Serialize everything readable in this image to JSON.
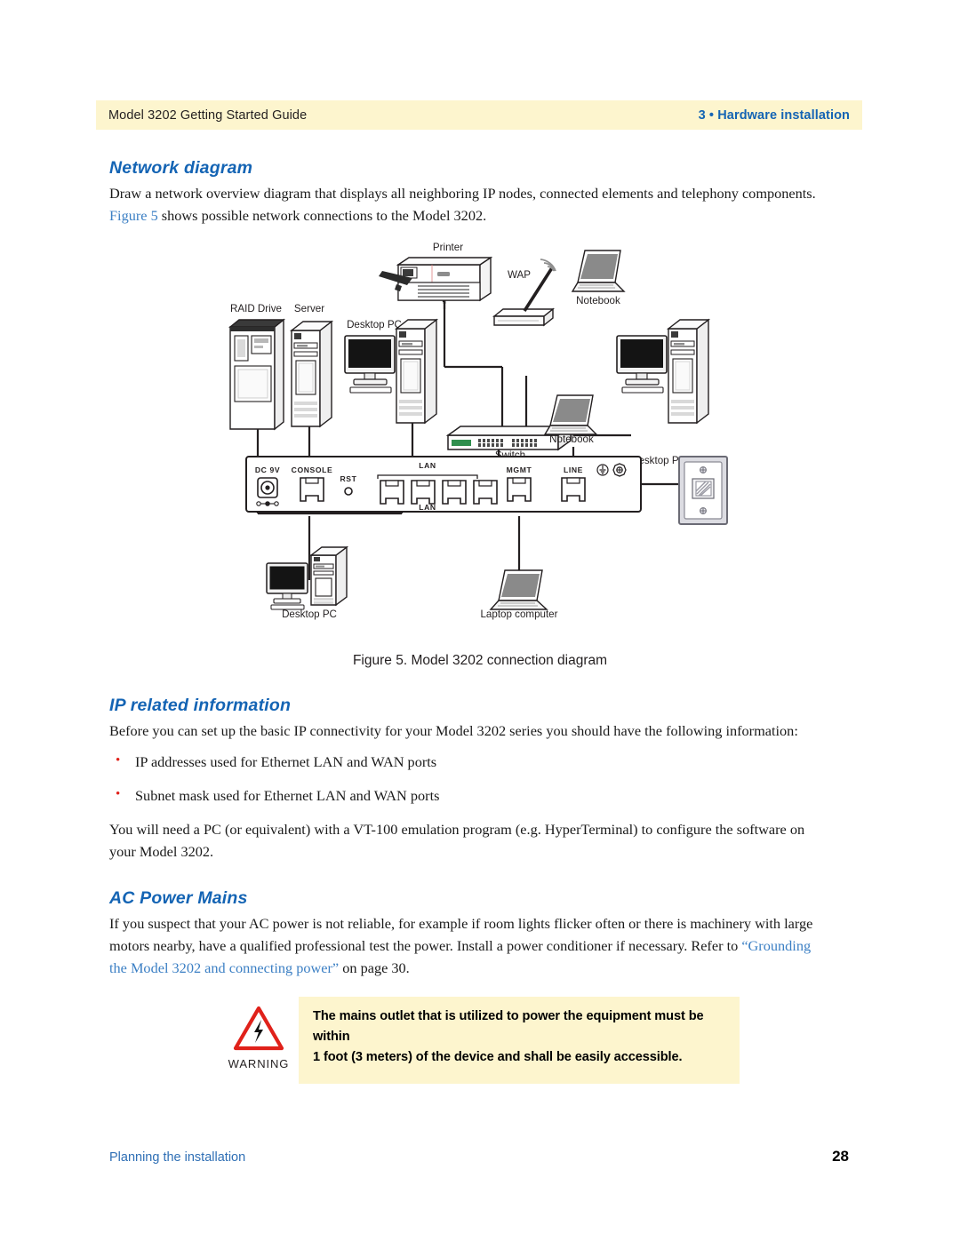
{
  "header": {
    "left": "Model 3202 Getting Started Guide",
    "right": "3 • Hardware installation",
    "band_color": "#FDF5CE",
    "accent_color": "#1464B4"
  },
  "sections": {
    "network_diagram": {
      "heading": "Network diagram",
      "paragraph_a": "Draw a network overview diagram that displays all neighboring IP nodes, connected elements and telephony components.",
      "figure_ref": "Figure 5",
      "paragraph_b": "shows possible network connections to the Model 3202."
    },
    "ip_related": {
      "heading": "IP related information",
      "paragraph": "Before you can set up the basic IP connectivity for your Model 3202 series you should have the following information:",
      "bullets": [
        "IP addresses used for Ethernet LAN and WAN ports",
        "Subnet mask used for Ethernet LAN and WAN ports"
      ],
      "closing": "You will need a PC (or equivalent) with a VT-100 emulation program (e.g. HyperTerminal) to configure the software on your Model 3202."
    },
    "ac_power": {
      "heading": "AC Power Mains",
      "paragraph_a": "If you suspect that your AC power is not reliable, for example if room lights flicker often or there is machinery with large motors nearby, have a qualified professional test the power. Install a power conditioner if necessary. Refer to",
      "link": "“Grounding the Model 3202 and connecting power”",
      "paragraph_b": "on page 30."
    }
  },
  "figure": {
    "caption": "Figure 5. Model 3202 connection diagram",
    "nodes": [
      {
        "label": "Printer"
      },
      {
        "label": "WAP"
      },
      {
        "label": "Notebook"
      },
      {
        "label": "RAID Drive"
      },
      {
        "label": "Server"
      },
      {
        "label": "Desktop PC"
      },
      {
        "label": "Switch"
      },
      {
        "label": "Desktop PC"
      },
      {
        "label": "Notebook"
      },
      {
        "label": "Desktop PC"
      },
      {
        "label": "Laptop computer"
      }
    ],
    "device_panel": {
      "ports": [
        {
          "label": "DC 9V"
        },
        {
          "label": "CONSOLE"
        },
        {
          "label": "RST"
        },
        {
          "label": "LAN"
        },
        {
          "label": "LAN"
        },
        {
          "label": "MGMT"
        },
        {
          "label": "LINE"
        }
      ]
    }
  },
  "warning": {
    "label": "WARNING",
    "line1": "The mains outlet that is utilized to power the equipment must be within",
    "line2": "1 foot (3 meters) of the device and shall be easily accessible.",
    "box_color": "#FDF5CE",
    "triangle_color": "#e0211a"
  },
  "footer": {
    "left": "Planning the installation",
    "page": "28"
  }
}
